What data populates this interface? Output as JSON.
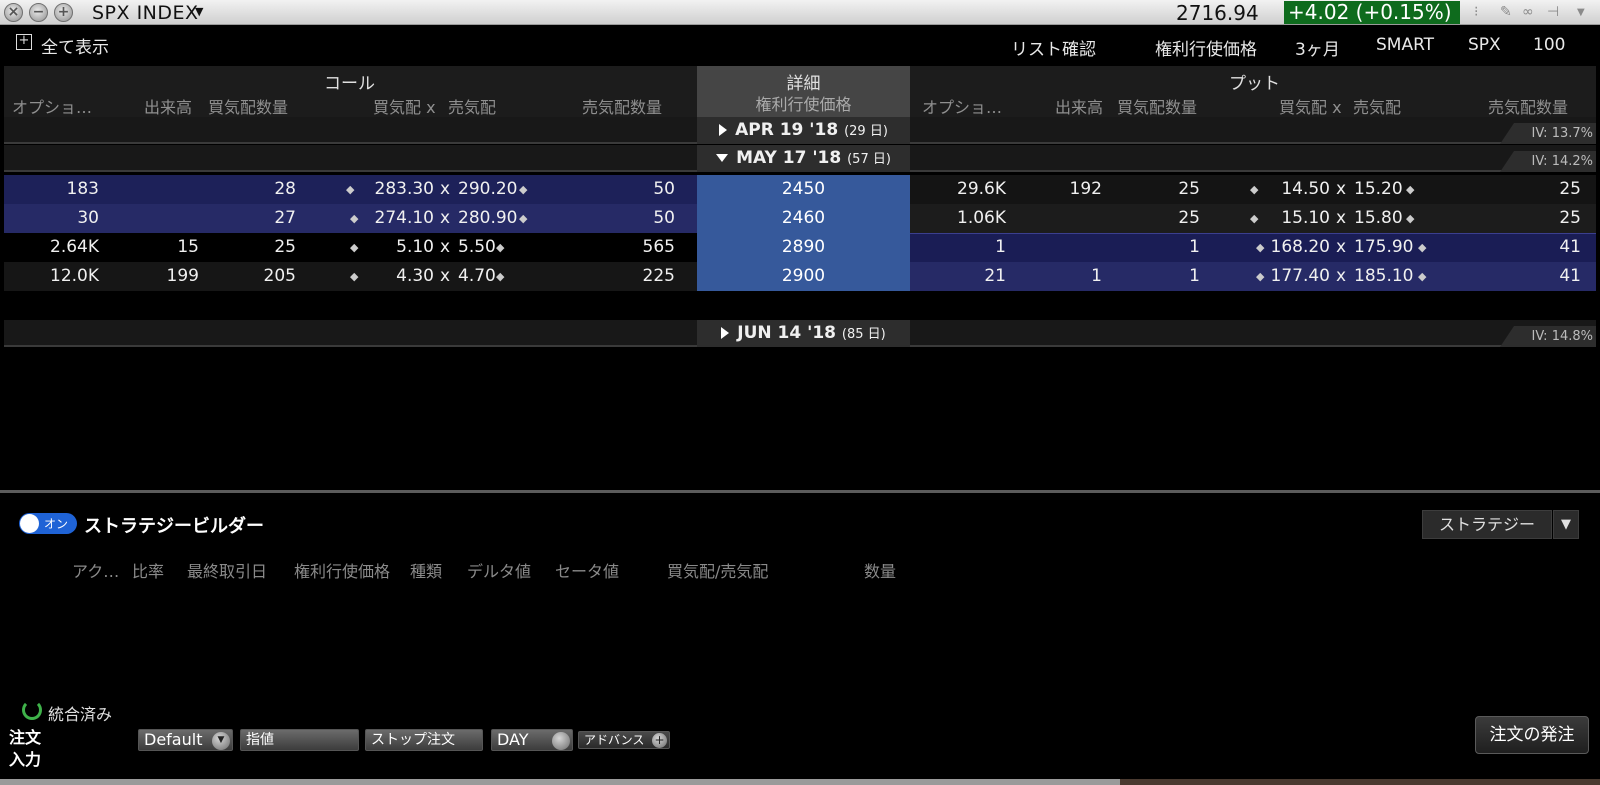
{
  "window": {
    "title": "SPX INDEX",
    "last_price": "2716.94",
    "change": "+4.02 (+0.15%)",
    "change_color": "#0e6b1d"
  },
  "toolbar": {
    "show_all": "全て表示",
    "list_confirm": "リスト確認",
    "strike_label": "権利行使価格",
    "range": "3ヶ月",
    "exchange": "SMART",
    "trading_class": "SPX",
    "multiplier": "100"
  },
  "calls": {
    "title": "コール",
    "columns": [
      "オプショ…",
      "出来高",
      "買気配数量",
      "買気配 x",
      "売気配",
      "売気配数量"
    ]
  },
  "center": {
    "title": "詳細",
    "subtitle": "権利行使価格"
  },
  "puts": {
    "title": "プット",
    "columns": [
      "オプショ…",
      "出来高",
      "買気配数量",
      "買気配 x",
      "売気配",
      "売気配数量"
    ]
  },
  "expirations": [
    {
      "label": "APR 19 '18",
      "days": "(29 日)",
      "iv": "IV: 13.7%",
      "expanded": false
    },
    {
      "label": "MAY 17 '18",
      "days": "(57 日)",
      "iv": "IV: 14.2%",
      "expanded": true
    },
    {
      "label": "JUN 14 '18",
      "days": "(85 日)",
      "iv": "IV: 14.8%",
      "expanded": false
    }
  ],
  "rows": [
    {
      "strike": "2450",
      "call": {
        "oi": "183",
        "vol": "",
        "bid_size": "28",
        "bid": "283.30",
        "ask": "290.20",
        "ask_size": "50"
      },
      "put": {
        "oi": "29.6K",
        "vol": "192",
        "bid_size": "25",
        "bid": "14.50",
        "ask": "15.20",
        "ask_size": "25"
      }
    },
    {
      "strike": "2460",
      "call": {
        "oi": "30",
        "vol": "",
        "bid_size": "27",
        "bid": "274.10",
        "ask": "280.90",
        "ask_size": "50"
      },
      "put": {
        "oi": "1.06K",
        "vol": "",
        "bid_size": "25",
        "bid": "15.10",
        "ask": "15.80",
        "ask_size": "25"
      }
    },
    {
      "strike": "2890",
      "call": {
        "oi": "2.64K",
        "vol": "15",
        "bid_size": "25",
        "bid": "5.10",
        "ask": "5.50",
        "ask_size": "565"
      },
      "put": {
        "oi": "1",
        "vol": "",
        "bid_size": "1",
        "bid": "168.20",
        "ask": "175.90",
        "ask_size": "41"
      }
    },
    {
      "strike": "2900",
      "call": {
        "oi": "12.0K",
        "vol": "199",
        "bid_size": "205",
        "bid": "4.30",
        "ask": "4.70",
        "ask_size": "225"
      },
      "put": {
        "oi": "21",
        "vol": "1",
        "bid_size": "1",
        "bid": "177.40",
        "ask": "185.10",
        "ask_size": "41"
      }
    }
  ],
  "separator": "x",
  "strategy_builder": {
    "toggle": "オン",
    "title": "ストラテジービルダー",
    "strategy_button": "ストラテジー",
    "columns": [
      "アク…",
      "比率",
      "最終取引日",
      "権利行使価格",
      "種類",
      "デルタ値",
      "セータ値",
      "買気配/売気配",
      "数量"
    ]
  },
  "order_entry": {
    "sync_label": "統合済み",
    "label": "注文\n入力",
    "account": "Default",
    "order_type": "指値",
    "stop": "ストップ注文",
    "tif": "DAY",
    "advanced": "アドバンス",
    "place_order": "注文の発注"
  }
}
